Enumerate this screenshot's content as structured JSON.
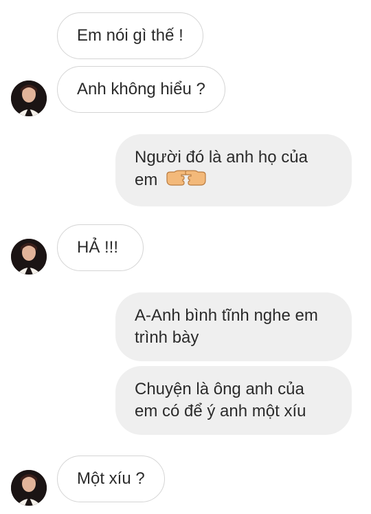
{
  "messages": [
    {
      "side": "in",
      "text": "Em nói gì thế !"
    },
    {
      "side": "in",
      "text": "Anh không hiểu ?"
    },
    {
      "side": "out",
      "line1": "Người đó là anh họ của",
      "line2": "em",
      "emoji": "pointing-hands-icon"
    },
    {
      "side": "in",
      "text": "HẢ !!!"
    },
    {
      "side": "out",
      "line1": "A-Anh bình tĩnh nghe em",
      "line2": "trình bày"
    },
    {
      "side": "out",
      "line1": "Chuyện là ông anh của",
      "line2": "em có để ý anh một xíu"
    },
    {
      "side": "in",
      "text": "Một xíu ?"
    }
  ],
  "colors": {
    "incoming_bg": "#ffffff",
    "incoming_border": "#d4d4d4",
    "outgoing_bg": "#efefef",
    "text": "#2b2b2b"
  }
}
